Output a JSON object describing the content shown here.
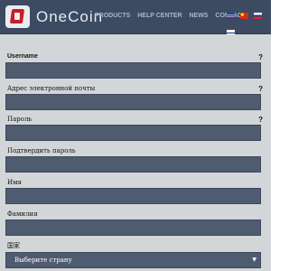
{
  "brand": "OneCoin",
  "nav": {
    "products": "PRODUCTS",
    "help_center": "HELP CENTER",
    "news": "NEWS",
    "contact": "CONTACT"
  },
  "languages": [
    {
      "name": "english-flag-icon",
      "color": "#2a3f8f"
    },
    {
      "name": "chinese-flag-icon",
      "color": "#d52b1e"
    },
    {
      "name": "russian-flag-icon",
      "color": "#ffffff"
    },
    {
      "name": "finnish-flag-icon",
      "color": "#ffffff"
    }
  ],
  "form": {
    "username_label": "Username",
    "email_label": "Адрес электронной почты",
    "password_label": "Пароль",
    "confirm_password_label": "Подтвердить пароль",
    "first_name_label": "Имя",
    "last_name_label": "Фамилия",
    "country_label": "国家",
    "country_value": "Выберите страну",
    "help_mark": "?",
    "dropdown_arrow": "▼"
  }
}
